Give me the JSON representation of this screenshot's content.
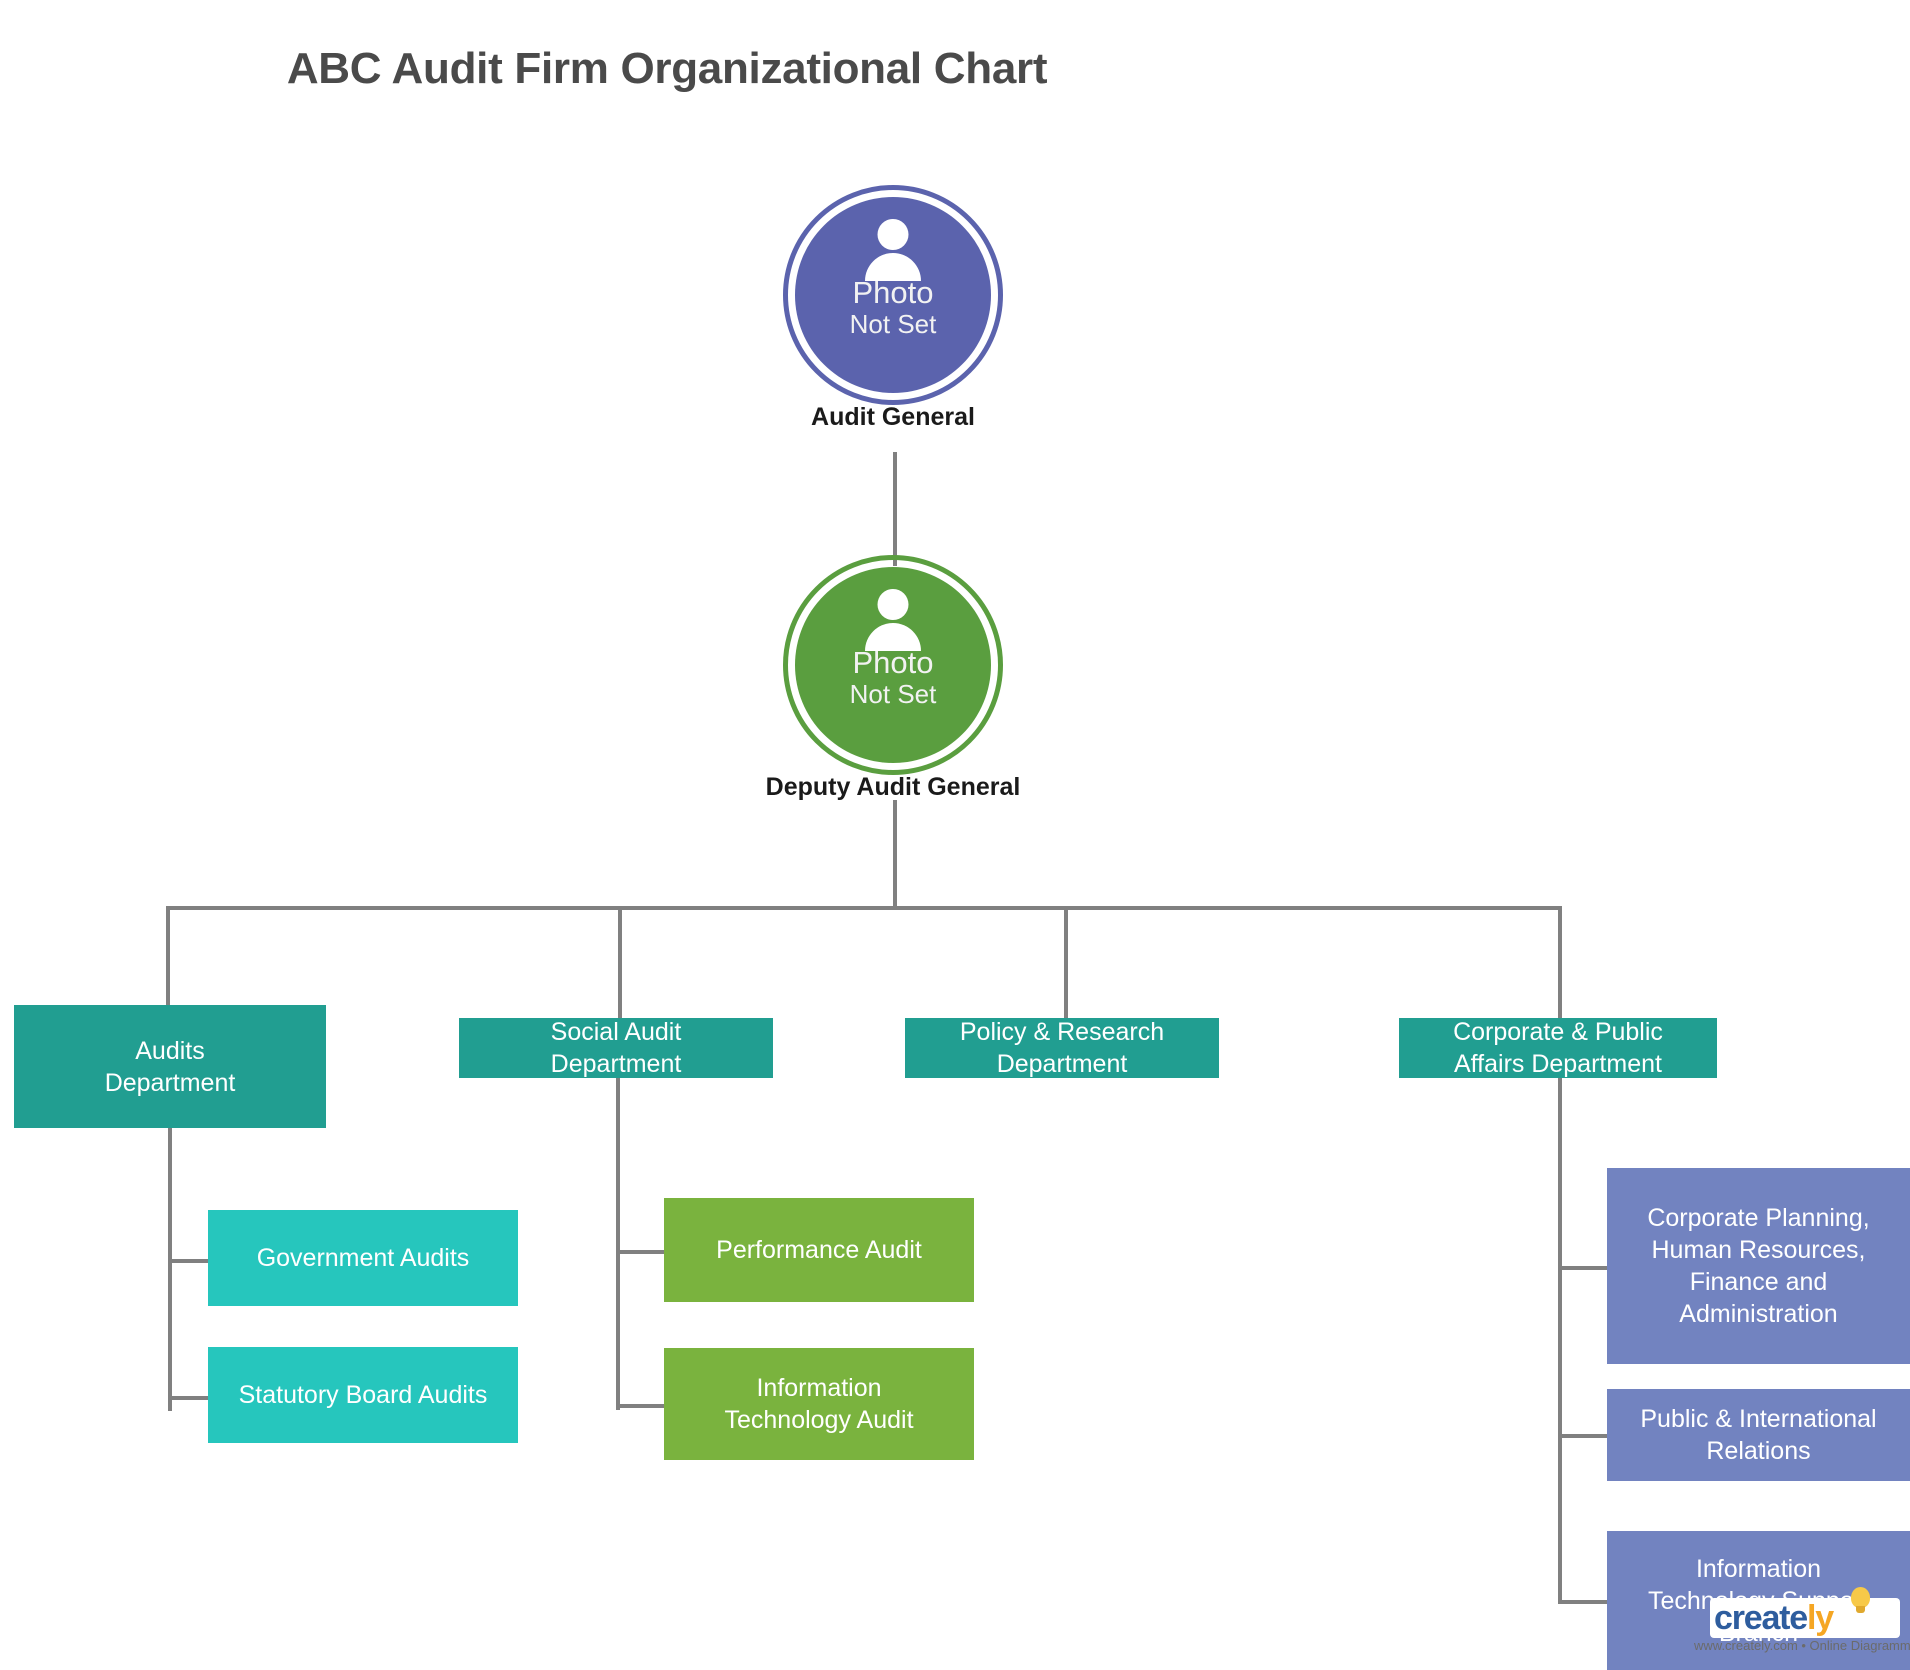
{
  "title": "ABC Audit Firm Organizational Chart",
  "avatar_placeholder": {
    "line1": "Photo",
    "line2": "Not Set"
  },
  "nodes": {
    "audit_general": {
      "label": "Audit General",
      "color": "#5b63ad"
    },
    "deputy_audit_general": {
      "label": "Deputy Audit General",
      "color": "#5a9e3f"
    }
  },
  "departments": [
    {
      "label": "Audits\nDepartment",
      "color": "#219e91"
    },
    {
      "label": "Social Audit\nDepartment",
      "color": "#219e91"
    },
    {
      "label": "Policy & Research\nDepartment",
      "color": "#219e91"
    },
    {
      "label": "Corporate & Public\nAffairs Department",
      "color": "#219e91"
    }
  ],
  "audits_children": [
    {
      "label": "Government Audits",
      "color": "#26c6bd"
    },
    {
      "label": "Statutory Board Audits",
      "color": "#26c6bd"
    }
  ],
  "social_audit_children": [
    {
      "label": "Performance Audit",
      "color": "#7ab33e"
    },
    {
      "label": "Information\nTechnology Audit",
      "color": "#7ab33e"
    }
  ],
  "corporate_children": [
    {
      "label": "Corporate Planning,\nHuman Resources,\nFinance and\nAdministration",
      "color": "#7283c0"
    },
    {
      "label": "Public & International\nRelations",
      "color": "#7283c0"
    },
    {
      "label": "Information\nTechnology Support\nBranch",
      "color": "#7283c0"
    }
  ],
  "watermark": {
    "brand_prefix": "create",
    "brand_suffix": "ly",
    "tagline": "www.creately.com • Online Diagramming"
  },
  "colors": {
    "connector": "#808080",
    "title": "#4a4a4a",
    "label": "#1a1a1a",
    "box_text": "#ffffff",
    "background": "#ffffff"
  }
}
